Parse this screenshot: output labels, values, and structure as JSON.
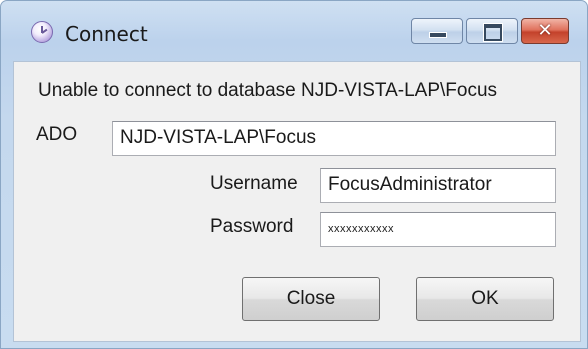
{
  "window": {
    "title": "Connect",
    "icon": "clock-icon",
    "caption_buttons": [
      "minimize-icon",
      "maximize-icon",
      "close-icon"
    ],
    "close_glyph": "✕"
  },
  "dialog": {
    "message": "Unable to connect to database NJD-VISTA-LAP\\Focus",
    "ado_label": "ADO",
    "ado_value": "NJD-VISTA-LAP\\Focus",
    "username_label": "Username",
    "username_value": "FocusAdministrator",
    "password_label": "Password",
    "password_value": "xxxxxxxxxxx",
    "close_button": "Close",
    "ok_button": "OK"
  }
}
